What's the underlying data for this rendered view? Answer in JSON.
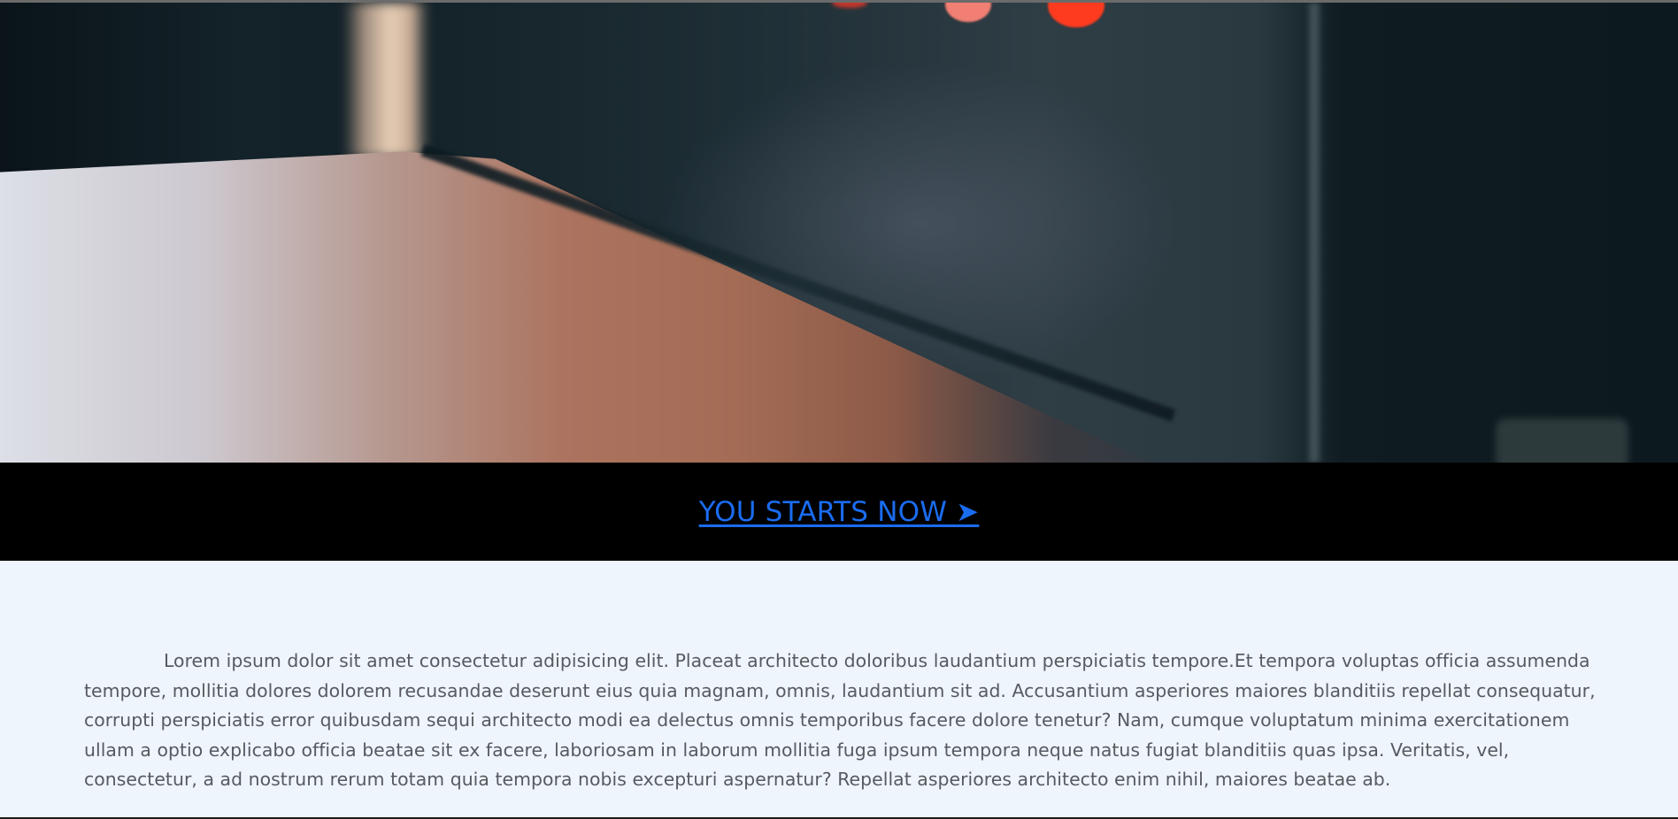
{
  "hero": {
    "image": "blurred-desk-photo",
    "colors": {
      "wall": "#1f2f36",
      "desk": "#ac7460",
      "light_red": "#ff3b1f",
      "light_pink": "#f27f73"
    }
  },
  "cta": {
    "label": "YOU STARTS NOW ➤",
    "color": "#1a6cf0",
    "band_color": "#000000"
  },
  "content": {
    "paragraph": "Lorem ipsum dolor sit amet consectetur adipisicing elit. Placeat architecto doloribus laudantium perspiciatis tempore.Et tempora voluptas officia assumenda tempore, mollitia dolores dolorem recusandae deserunt eius quia magnam, omnis, laudantium sit ad. Accusantium asperiores maiores blanditiis repellat consequatur, corrupti perspiciatis error quibusdam sequi architecto modi ea delectus omnis temporibus facere dolore tenetur? Nam, cumque voluptatum minima exercitationem ullam a optio explicabo officia beatae sit ex facere, laboriosam in laborum mollitia fuga ipsum tempora neque natus fugiat blanditiis quas ipsa. Veritatis, vel, consectetur, a ad nostrum rerum totam quia tempora nobis excepturi aspernatur? Repellat asperiores architecto enim nihil, maiores beatae ab.",
    "background": "#eef5fc",
    "text_color": "#575a60"
  }
}
